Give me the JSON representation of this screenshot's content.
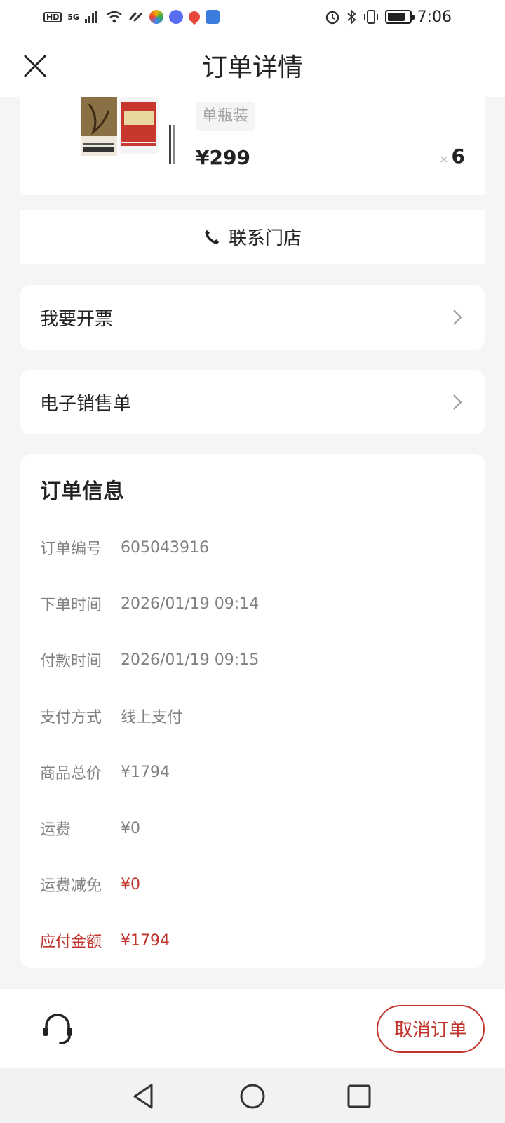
{
  "status_bar": {
    "time": "7:06",
    "network": "5G",
    "hd": "HD"
  },
  "header": {
    "title": "订单详情"
  },
  "product": {
    "spec": "单瓶装",
    "price": "¥299",
    "quantity": "6",
    "quantity_prefix": "×"
  },
  "contact": {
    "label": "联系门店"
  },
  "rows": {
    "invoice": "我要开票",
    "receipt": "电子销售单"
  },
  "order_info": {
    "title": "订单信息",
    "items": [
      {
        "label": "订单编号",
        "value": "605043916"
      },
      {
        "label": "下单时间",
        "value": "2026/01/19 09:14"
      },
      {
        "label": "付款时间",
        "value": "2026/01/19 09:15"
      },
      {
        "label": "支付方式",
        "value": "线上支付"
      },
      {
        "label": "商品总价",
        "value": "¥1794"
      },
      {
        "label": "运费",
        "value": "¥0"
      },
      {
        "label": "运费减免",
        "value": "¥0"
      },
      {
        "label": "应付金额",
        "value": "¥1794"
      }
    ]
  },
  "bottom": {
    "cancel_label": "取消订单"
  },
  "colors": {
    "accent": "#c0342c",
    "background": "#f5f5f5",
    "card": "#ffffff",
    "muted_text": "#808080"
  }
}
